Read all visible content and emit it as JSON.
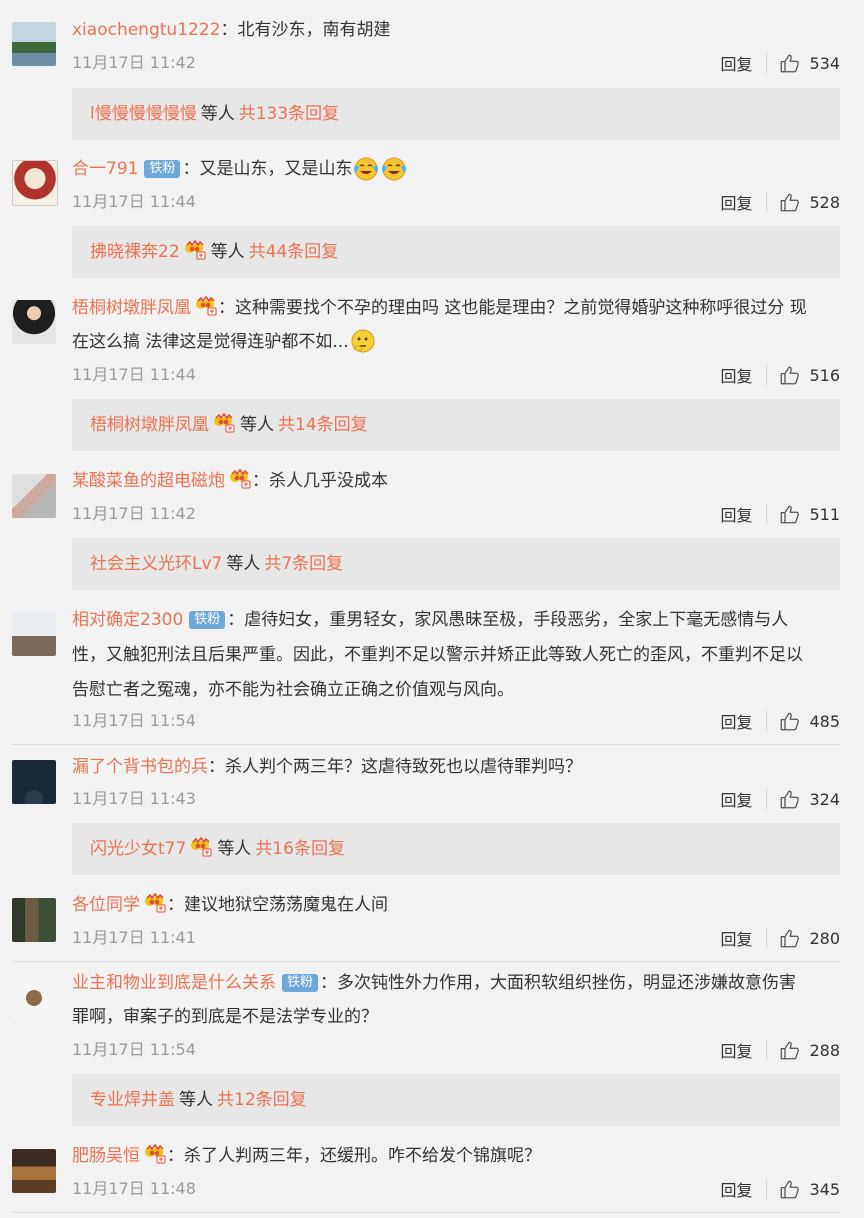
{
  "comments": [
    {
      "name": "xiaochengtu1222",
      "sep": "：",
      "text": "北有沙东，南有胡建",
      "time": "11月17日 11:42",
      "reply": "回复",
      "likes": "534",
      "replies_from": "l慢慢慢慢慢慢",
      "others": "等人",
      "reply_count": "共133条回复"
    },
    {
      "name": "合一791",
      "fan_badge": "铁粉",
      "sep": "：",
      "text": "又是山东，又是山东",
      "emoji": "laughing-crying-emoji",
      "time": "11月17日 11:44",
      "reply": "回复",
      "likes": "528",
      "replies_from": "拂晓裸奔22",
      "others": "等人",
      "reply_count": "共44条回复"
    },
    {
      "name": "梧桐树墩胖凤凰",
      "sep": "：",
      "text_line1": "这种需要找个不孕的理由吗 这也能是理由？之前觉得婚驴这种称呼很过分 现",
      "text_line2": "在这么搞 法律这是觉得连驴都不如...",
      "emoji": "thinking-emoji",
      "time": "11月17日 11:44",
      "reply": "回复",
      "likes": "516",
      "replies_from": "梧桐树墩胖凤凰",
      "others": "等人",
      "reply_count": "共14条回复"
    },
    {
      "name": "某酸菜鱼的超电磁炮",
      "sep": "：",
      "text": "杀人几乎没成本",
      "time": "11月17日 11:42",
      "reply": "回复",
      "likes": "511",
      "replies_from": "社会主义光环Lv7",
      "others": "等人",
      "reply_count": "共7条回复"
    },
    {
      "name": "相对确定2300",
      "fan_badge": "铁粉",
      "sep": "：",
      "text_line1": "虐待妇女，重男轻女，家风愚昧至极，手段恶劣，全家上下毫无感情与人",
      "text_line2": "性，又触犯刑法且后果严重。因此，不重判不足以警示并矫正此等致人死亡的歪风，不重判不足以",
      "text_line3": "告慰亡者之冤魂，亦不能为社会确立正确之价值观与风向。",
      "time": "11月17日 11:54",
      "reply": "回复",
      "likes": "485"
    },
    {
      "name": "漏了个背书包的兵",
      "sep": "：",
      "text": "杀人判个两三年？这虐待致死也以虐待罪判吗？",
      "time": "11月17日 11:43",
      "reply": "回复",
      "likes": "324",
      "replies_from": "闪光少女t77",
      "others": "等人",
      "reply_count": "共16条回复"
    },
    {
      "name": "各位同学",
      "sep": "：",
      "text": "建议地狱空荡荡魔鬼在人间",
      "time": "11月17日 11:41",
      "reply": "回复",
      "likes": "280"
    },
    {
      "name": "业主和物业到底是什么关系",
      "fan_badge": "铁粉",
      "sep": "：",
      "text_line1": "多次钝性外力作用，大面积软组织挫伤，明显还涉嫌故意伤害",
      "text_line2": "罪啊，审案子的到底是不是法学专业的？",
      "time": "11月17日 11:54",
      "reply": "回复",
      "likes": "288",
      "replies_from": "专业焊井盖",
      "others": "等人",
      "reply_count": "共12条回复"
    },
    {
      "name": "肥肠吴恒",
      "sep": "：",
      "text": "杀了人判两三年，还缓刑。咋不给发个锦旗呢？",
      "time": "11月17日 11:48",
      "reply": "回复",
      "likes": "345"
    }
  ],
  "icons": {
    "like": "thumbs-up-icon",
    "crown": "crown-badge-icon"
  },
  "colors": {
    "name": "#eb7350",
    "time": "#9b9b9b",
    "fan_badge": "#6ea8db",
    "reply_box": "#e7e7e7",
    "background": "#f2f2f2"
  }
}
